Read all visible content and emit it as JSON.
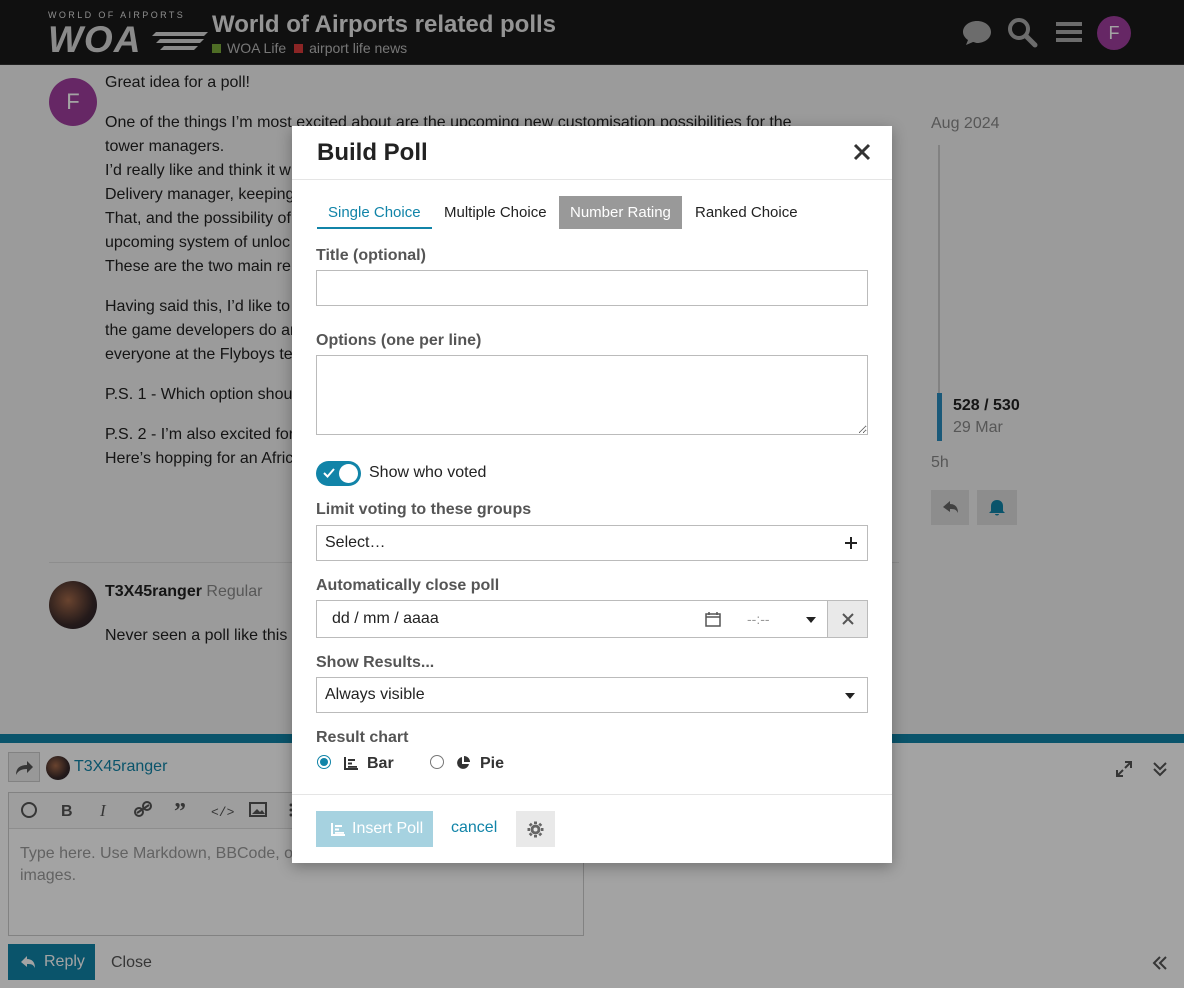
{
  "header": {
    "logo_small": "WORLD OF AIRPORTS",
    "logo_text": "WOA",
    "title": "World of Airports related polls",
    "categories": [
      {
        "label": "WOA Life",
        "color": "#7bab3b"
      },
      {
        "label": "airport life news",
        "color": "#d93a3a"
      }
    ],
    "user_initial": "F"
  },
  "post": {
    "avatar_initial": "F",
    "lines": [
      "Great idea for a poll!",
      "One of the things I’m most excited about are the upcoming new customisation possibilities for the",
      "tower managers.",
      "I’d really like and think it w",
      "Delivery manager, keeping",
      "That, and the possibility of",
      "upcoming system of unloc",
      "These are the two main re",
      "Having said this, I’d like to",
      "the game developers do ar",
      "everyone at the Flyboys te",
      "P.S. 1 - Which option shou",
      "P.S. 2 - I’m also excited for",
      "Here’s hopping for an Afric"
    ]
  },
  "timeline": {
    "start": "Aug 2024",
    "position": "528 / 530",
    "date": "29 Mar",
    "ago": "5h"
  },
  "post2": {
    "author": "T3X45ranger",
    "title": "Regular",
    "text": "Never seen a poll like this"
  },
  "composer": {
    "username": "T3X45ranger",
    "placeholder": "Type here. Use Markdown, BBCode, or images.",
    "reply_label": "Reply",
    "close_label": "Close"
  },
  "modal": {
    "title": "Build Poll",
    "tabs": [
      "Single Choice",
      "Multiple Choice",
      "Number Rating",
      "Ranked Choice"
    ],
    "title_label": "Title (optional)",
    "title_value": "",
    "options_label": "Options (one per line)",
    "options_value": "",
    "show_who_voted_label": "Show who voted",
    "show_who_voted": true,
    "groups_label": "Limit voting to these groups",
    "groups_placeholder": "Select…",
    "close_label": "Automatically close poll",
    "date_placeholder": "dd / mm / aaaa",
    "time_placeholder": "--:--",
    "results_label": "Show Results...",
    "results_value": "Always visible",
    "chart_label": "Result chart",
    "chart_options": [
      "Bar",
      "Pie"
    ],
    "chart_selected": "Bar",
    "insert_label": "Insert Poll",
    "cancel_label": "cancel",
    "accent_color": "#1184a8"
  }
}
